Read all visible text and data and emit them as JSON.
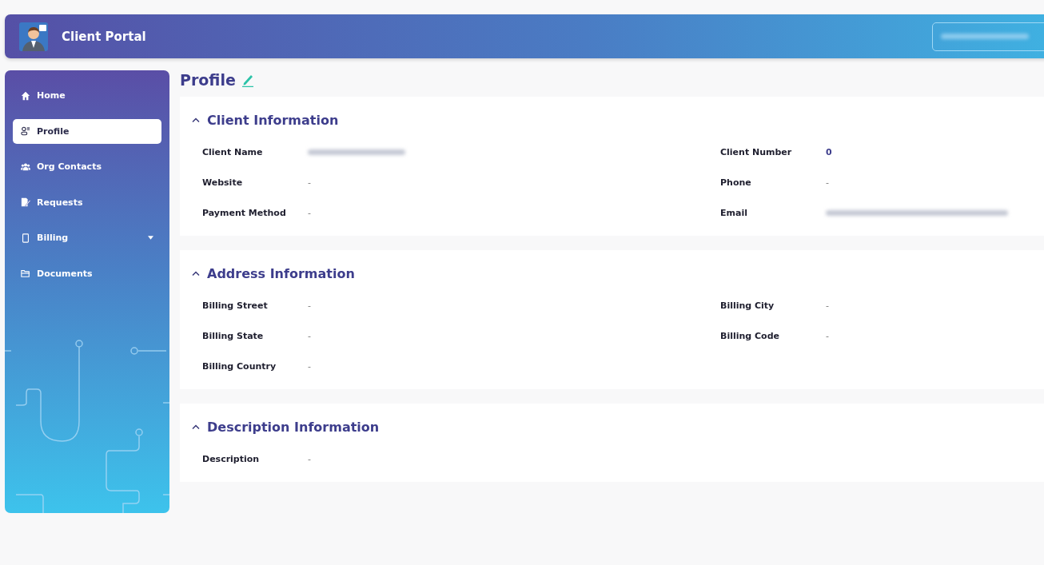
{
  "header": {
    "title": "Client Portal",
    "account_button": {
      "redacted": true
    }
  },
  "sidebar": {
    "items": [
      {
        "label": "Home",
        "selected": false,
        "expandable": false
      },
      {
        "label": "Profile",
        "selected": true,
        "expandable": false
      },
      {
        "label": "Org Contacts",
        "selected": false,
        "expandable": false
      },
      {
        "label": "Requests",
        "selected": false,
        "expandable": false
      },
      {
        "label": "Billing",
        "selected": false,
        "expandable": true
      },
      {
        "label": "Documents",
        "selected": false,
        "expandable": false
      }
    ]
  },
  "page_title": "Profile",
  "sections": [
    {
      "title": "Client Information",
      "expanded": true,
      "left": [
        {
          "label": "Client Name",
          "redacted": true
        },
        {
          "label": "Website",
          "value": "-"
        },
        {
          "label": "Payment Method",
          "value": "-"
        }
      ],
      "right": [
        {
          "label": "Client Number",
          "value": "0",
          "highlight": true
        },
        {
          "label": "Phone",
          "value": "-"
        },
        {
          "label": "Email",
          "redacted": true
        }
      ]
    },
    {
      "title": "Address Information",
      "expanded": true,
      "left": [
        {
          "label": "Billing Street",
          "value": "-"
        },
        {
          "label": "Billing State",
          "value": "-"
        },
        {
          "label": "Billing Country",
          "value": "-"
        }
      ],
      "right": [
        {
          "label": "Billing City",
          "value": "-"
        },
        {
          "label": "Billing Code",
          "value": "-"
        }
      ]
    },
    {
      "title": "Description Information",
      "expanded": true,
      "left": [
        {
          "label": "Description",
          "value": "-"
        }
      ]
    }
  ]
}
